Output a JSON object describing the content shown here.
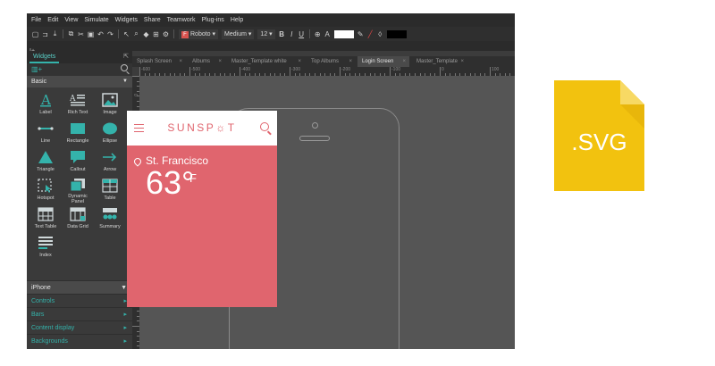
{
  "menu": [
    "File",
    "Edit",
    "View",
    "Simulate",
    "Widgets",
    "Share",
    "Teamwork",
    "Plug-ins",
    "Help"
  ],
  "toolbar": {
    "font_family": "Roboto",
    "font_weight": "Medium",
    "font_size": "12",
    "bold": "B",
    "italic": "I",
    "underline": "U",
    "text_color_label": "A"
  },
  "subbar": "I+",
  "left_panel": {
    "tab": "Widgets",
    "library_section": "Basic",
    "widgets": [
      {
        "label": "Label",
        "icon": "label-icon"
      },
      {
        "label": "Rich Text",
        "icon": "rich-text-icon"
      },
      {
        "label": "Image",
        "icon": "image-icon"
      },
      {
        "label": "Line",
        "icon": "line-icon"
      },
      {
        "label": "Rectangle",
        "icon": "rectangle-icon"
      },
      {
        "label": "Ellipse",
        "icon": "ellipse-icon"
      },
      {
        "label": "Triangle",
        "icon": "triangle-icon"
      },
      {
        "label": "Callout",
        "icon": "callout-icon"
      },
      {
        "label": "Arrow",
        "icon": "arrow-icon"
      },
      {
        "label": "Hotspot",
        "icon": "hotspot-icon"
      },
      {
        "label": "Dynamic Panel",
        "icon": "dynamic-panel-icon"
      },
      {
        "label": "Table",
        "icon": "table-icon"
      },
      {
        "label": "Text Table",
        "icon": "text-table-icon"
      },
      {
        "label": "Data Grid",
        "icon": "data-grid-icon"
      },
      {
        "label": "Summary",
        "icon": "summary-icon"
      },
      {
        "label": "Index",
        "icon": "index-icon"
      }
    ],
    "categories": [
      {
        "label": "iPhone",
        "head": true
      },
      {
        "label": "Controls",
        "head": false
      },
      {
        "label": "Bars",
        "head": false
      },
      {
        "label": "Content display",
        "head": false
      },
      {
        "label": "Backgrounds",
        "head": false
      }
    ]
  },
  "tabs": [
    {
      "label": "Splash Screen",
      "active": false
    },
    {
      "label": "Albums",
      "active": false
    },
    {
      "label": "Master_Template white",
      "active": false
    },
    {
      "label": "Top Albums",
      "active": false
    },
    {
      "label": "Login Screen",
      "active": true
    },
    {
      "label": "Master_Template",
      "active": false
    }
  ],
  "ruler_h": [
    "-600",
    "-500",
    "-400",
    "-300",
    "-200",
    "-100",
    "0",
    "100"
  ],
  "ruler_v": [
    "0",
    "100",
    "200",
    "300"
  ],
  "app": {
    "brand": "SUNSP☼T",
    "city": "St. Francisco",
    "temperature": "63°",
    "unit": "F",
    "accent": "#e0656e"
  },
  "file_badge": {
    "extension": ".SVG",
    "color": "#f2c20f"
  },
  "colors": {
    "teal": "#34b3ab",
    "panel": "#3a3a3a"
  }
}
